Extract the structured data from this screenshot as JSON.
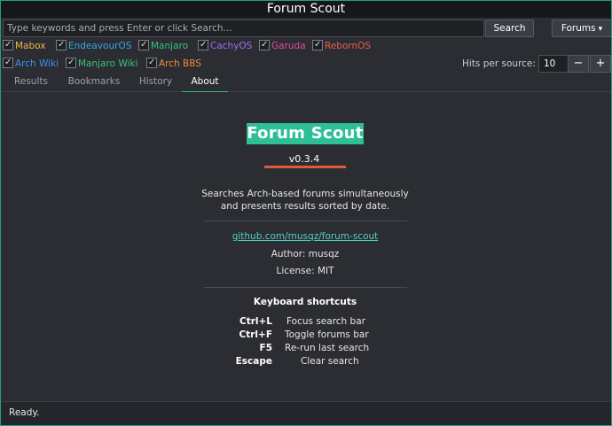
{
  "window": {
    "title": "Forum Scout"
  },
  "search": {
    "placeholder": "Type keywords and press Enter or click Search...",
    "button_label": "Search",
    "forums_label": "Forums",
    "forums_chevron": "▾"
  },
  "sources": {
    "row1": [
      {
        "name": "Mabox",
        "color": "#e9b949"
      },
      {
        "name": "EndeavourOS",
        "color": "#35a8e6"
      },
      {
        "name": "Manjaro",
        "color": "#36c47a"
      },
      {
        "name": "CachyOS",
        "color": "#a66cf0"
      },
      {
        "name": "Garuda",
        "color": "#e84a9a"
      },
      {
        "name": "RebornOS",
        "color": "#f05a4a"
      }
    ],
    "row2": [
      {
        "name": "Arch Wiki",
        "color": "#3d8ef0"
      },
      {
        "name": "Manjaro Wiki",
        "color": "#36c47a"
      },
      {
        "name": "Arch BBS",
        "color": "#f08a3a"
      }
    ]
  },
  "hits": {
    "label": "Hits per source:",
    "value": "10",
    "minus": "−",
    "plus": "+"
  },
  "tabs": [
    "Results",
    "Bookmarks",
    "History",
    "About"
  ],
  "about": {
    "app_name": "Forum Scout",
    "version": "v0.3.4",
    "description_line1": "Searches Arch-based forums simultaneously",
    "description_line2": "and presents results sorted by date.",
    "repo_link": "github.com/musqz/forum-scout",
    "author": "Author: musqz",
    "license": "License: MIT",
    "shortcuts_title": "Keyboard shortcuts",
    "shortcuts": [
      {
        "key": "Ctrl+L",
        "desc": "Focus search bar"
      },
      {
        "key": "Ctrl+F",
        "desc": "Toggle forums bar"
      },
      {
        "key": "F5",
        "desc": "Re-run last search"
      },
      {
        "key": "Escape",
        "desc": "Clear search"
      }
    ]
  },
  "status": {
    "text": "Ready."
  },
  "colors": {
    "accent": "#2fbf97",
    "version_bar": "#e05a3a",
    "link": "#4fd3c0"
  }
}
